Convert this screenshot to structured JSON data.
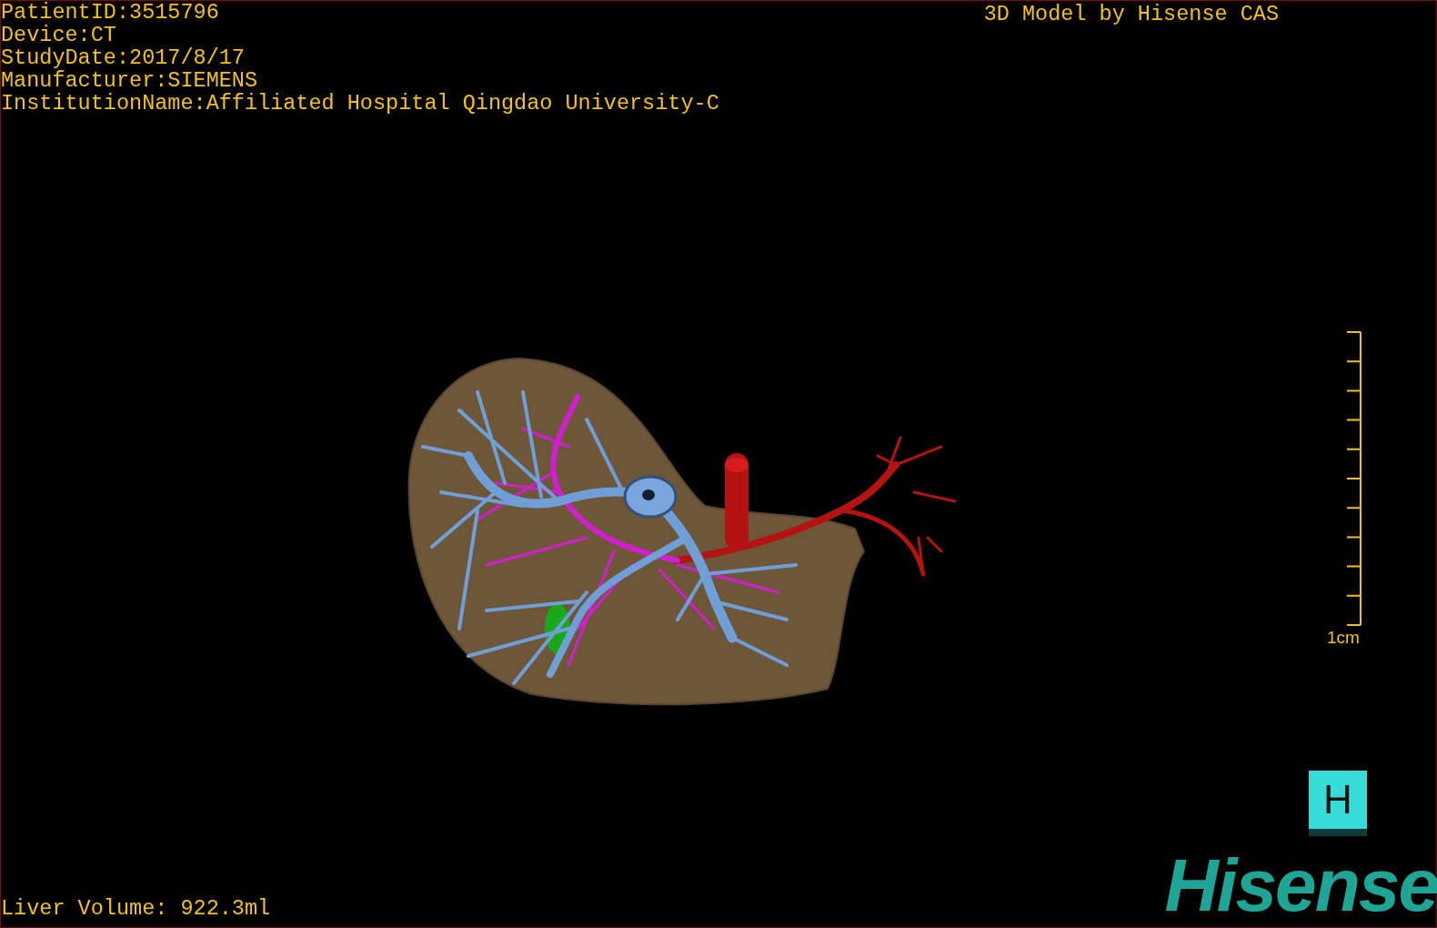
{
  "info_lines": [
    "PatientID:3515796",
    "Device:CT",
    "StudyDate:2017/8/17",
    "Manufacturer:SIEMENS",
    "InstitutionName:Affiliated Hospital Qingdao University-C"
  ],
  "title": "3D Model by Hisense CAS",
  "scale_bar": {
    "label": "1cm"
  },
  "liver_volume": "Liver Volume: 922.3ml",
  "h_button": {
    "label": "H"
  },
  "logo": "Hisense"
}
